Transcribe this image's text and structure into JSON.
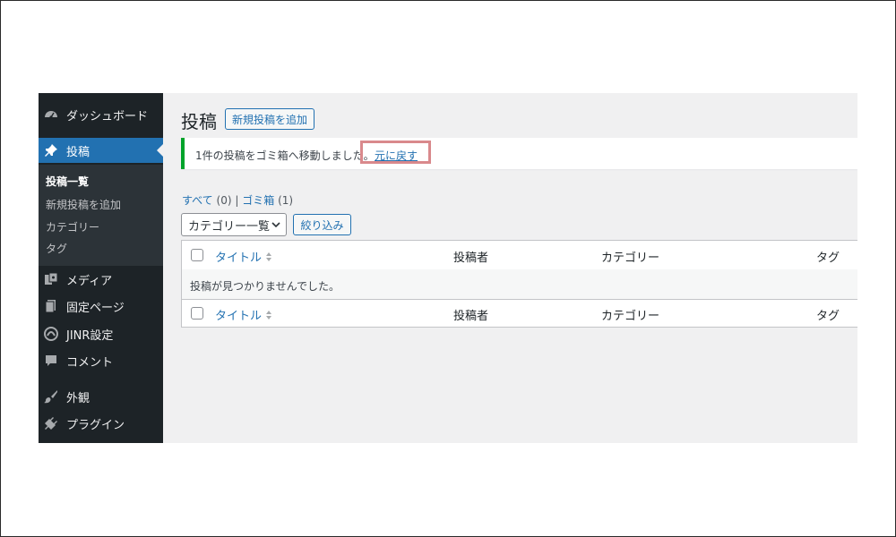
{
  "sidebar": {
    "items": [
      {
        "label": "ダッシュボード",
        "icon": "dashboard-icon"
      },
      {
        "label": "投稿",
        "icon": "pushpin-icon",
        "active": true
      },
      {
        "label": "メディア",
        "icon": "media-icon"
      },
      {
        "label": "固定ページ",
        "icon": "page-icon"
      },
      {
        "label": "JINR設定",
        "icon": "jinr-settings-icon"
      },
      {
        "label": "コメント",
        "icon": "comment-icon"
      },
      {
        "label": "外観",
        "icon": "appearance-icon"
      },
      {
        "label": "プラグイン",
        "icon": "plugin-icon"
      }
    ],
    "submenu": [
      {
        "label": "投稿一覧",
        "current": true
      },
      {
        "label": "新規投稿を追加"
      },
      {
        "label": "カテゴリー"
      },
      {
        "label": "タグ"
      }
    ]
  },
  "main": {
    "title": "投稿",
    "add_new_label": "新規投稿を追加",
    "notice": {
      "message": "1件の投稿をゴミ箱へ移動しました。",
      "undo_label": "元に戻す"
    },
    "filters": {
      "all_label": "すべて",
      "all_count": "(0)",
      "separator": "|",
      "trash_label": "ゴミ箱",
      "trash_count": "(1)"
    },
    "category_select": {
      "selected": "カテゴリー一覧"
    },
    "filter_button_label": "絞り込み",
    "table": {
      "columns": {
        "title": "タイトル",
        "author": "投稿者",
        "categories": "カテゴリー",
        "tags": "タグ"
      },
      "empty_message": "投稿が見つかりませんでした。"
    }
  },
  "colors": {
    "sidebar_bg": "#1d2327",
    "active_menu": "#2271b1",
    "link": "#2271b1",
    "notice_success": "#00a32a",
    "highlight_box": "#d9898c"
  }
}
